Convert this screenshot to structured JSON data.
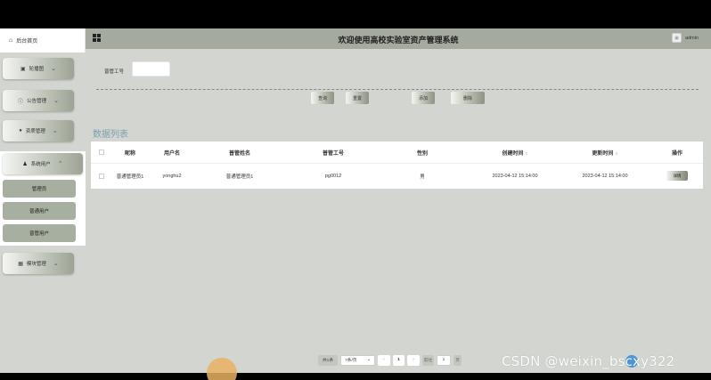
{
  "sidebar": {
    "home": "后台首页",
    "menus": [
      {
        "label": "轮播图",
        "icon": "image-icon"
      },
      {
        "label": "公告管理",
        "icon": "info-circle-icon"
      },
      {
        "label": "资质管理",
        "icon": "location-pin-icon"
      },
      {
        "label": "系统用户",
        "icon": "user-icon"
      }
    ],
    "sub_items": [
      "管理员",
      "普通用户",
      "普管用户"
    ],
    "bottom_menu": {
      "label": "模块管理",
      "icon": "grid-icon"
    }
  },
  "header": {
    "title": "欢迎使用高校实验室资产管理系统",
    "user": "admin"
  },
  "search": {
    "label": "普管工号",
    "value": ""
  },
  "actions": {
    "query": "查询",
    "reset": "重置",
    "add": "添加",
    "delete": "删除"
  },
  "section_title": "数据列表",
  "table": {
    "headers": [
      "昵称",
      "用户名",
      "普管姓名",
      "普管工号",
      "性别",
      "创建时间",
      "更新时间",
      "操作"
    ],
    "sort_mark": "⇕",
    "rows": [
      {
        "nickname": "普通管理员1",
        "username": "yonghu2",
        "name": "普通管理员1",
        "id": "pg0012",
        "gender": "男",
        "created": "2023-04-12 15:14:00",
        "updated": "2023-04-12 15:14:00",
        "op": "详情"
      }
    ]
  },
  "pager": {
    "total": "共1条",
    "page_size": "7条/页",
    "prev": "<",
    "current": "1",
    "next": ">",
    "goto_label": "前往",
    "goto_value": "1",
    "page_unit": "页"
  },
  "watermark": "CSDN @weixin_bscxy322"
}
